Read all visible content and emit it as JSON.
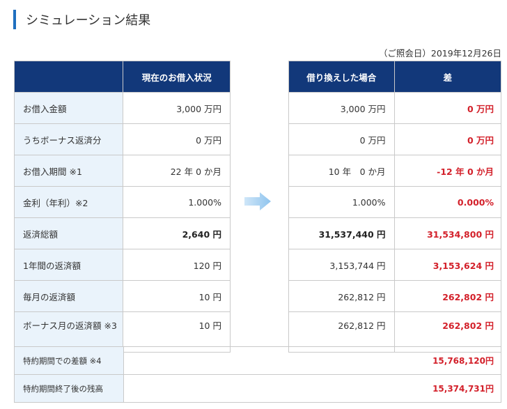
{
  "header": {
    "title": "シミュレーション結果"
  },
  "reference_date": "（ご照会日）2019年12月26日",
  "left_table": {
    "header": "現在のお借入状況",
    "rows": [
      {
        "label": "お借入金額",
        "value": "3,000 万円"
      },
      {
        "label": "うちボーナス返済分",
        "value": "0 万円"
      },
      {
        "label": "お借入期間 ※1",
        "value": "22 年 0 か月"
      },
      {
        "label": "金利（年利）※2",
        "value": "1.000%"
      },
      {
        "label": "返済総額",
        "value": "2,640 円"
      },
      {
        "label": "1年間の返済額",
        "value": "120 円"
      },
      {
        "label": "毎月の返済額",
        "value": "10 円"
      },
      {
        "label": "ボーナス月の返済額 ※3",
        "value": "10 円"
      }
    ]
  },
  "right_table": {
    "headers": [
      "借り換えした場合",
      "差"
    ],
    "rows": [
      {
        "value": "3,000 万円",
        "diff": "0 万円"
      },
      {
        "value": "0 万円",
        "diff": "0 万円"
      },
      {
        "value": "10 年　0 か月",
        "diff": "-12 年 0 か月"
      },
      {
        "value": "1.000%",
        "diff": "0.000%"
      },
      {
        "value": "31,537,440 円",
        "diff": "31,534,800 円"
      },
      {
        "value": "3,153,744 円",
        "diff": "3,153,624 円"
      },
      {
        "value": "262,812 円",
        "diff": "262,802 円"
      },
      {
        "value": "262,812 円",
        "diff": "262,802 円"
      }
    ]
  },
  "bottom_table": {
    "rows": [
      {
        "label": "特約期間での差額 ※4",
        "diff": "15,768,120円"
      },
      {
        "label": "特約期間終了後の残高",
        "diff": "15,374,731円"
      }
    ]
  },
  "icons": {
    "arrow": "arrow-right-icon"
  },
  "colors": {
    "accent": "#1f6fbf",
    "header_bg": "#12387a",
    "label_bg": "#eaf3fb",
    "diff_red": "#d3202a"
  }
}
